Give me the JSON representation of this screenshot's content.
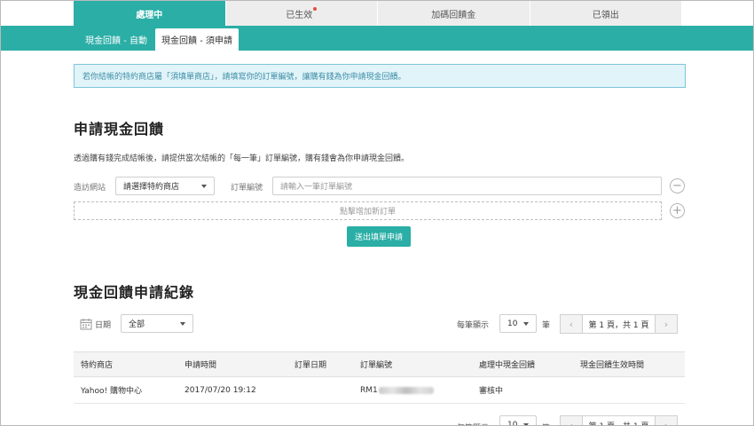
{
  "top_tabs": [
    {
      "label": "處理中",
      "active": true
    },
    {
      "label": "已生效",
      "has_dot": true
    },
    {
      "label": "加碼回饋金"
    },
    {
      "label": "已領出"
    }
  ],
  "sub_tabs": [
    {
      "label": "現金回饋 - 自動"
    },
    {
      "label": "現金回饋 - 須申請",
      "active": true
    }
  ],
  "notice": "若你結帳的特約商店屬「須填單商店」，請填寫你的訂單編號，讓購有錢為你申請現金回饋。",
  "apply": {
    "title": "申請現金回饋",
    "description": "透過購有錢完成結帳後，請提供當次結帳的「每一筆」訂單編號，購有錢會為你申請現金回饋。",
    "site_label": "造訪網站",
    "site_select": "請選擇特約商店",
    "order_label": "訂單編號",
    "order_placeholder": "請輸入一筆訂單編號",
    "add_row_label": "點擊增加新訂單",
    "submit_label": "送出填單申請"
  },
  "records": {
    "title": "現金回饋申請紀錄",
    "date_label": "日期",
    "date_filter": "全部",
    "per_page_label": "每筆顯示",
    "per_page_value": "10",
    "per_page_suffix": "筆",
    "page_info": "第 1 頁，共 1 頁",
    "prev_icon": "‹",
    "next_icon": "›",
    "columns": [
      "特約商店",
      "申請時間",
      "訂單日期",
      "訂單編號",
      "處理中現金回饋",
      "現金回饋生效時間"
    ],
    "rows": [
      {
        "store": "Yahoo! 購物中心",
        "applied_at": "2017/07/20 19:12",
        "order_date": "",
        "order_no": "RM1",
        "status": "審核中",
        "effective": ""
      }
    ]
  },
  "colors": {
    "accent": "#2aaea6",
    "notice_bg": "#e1f4fa",
    "notice_text": "#3e8ea6",
    "dot": "#e74c3c"
  }
}
